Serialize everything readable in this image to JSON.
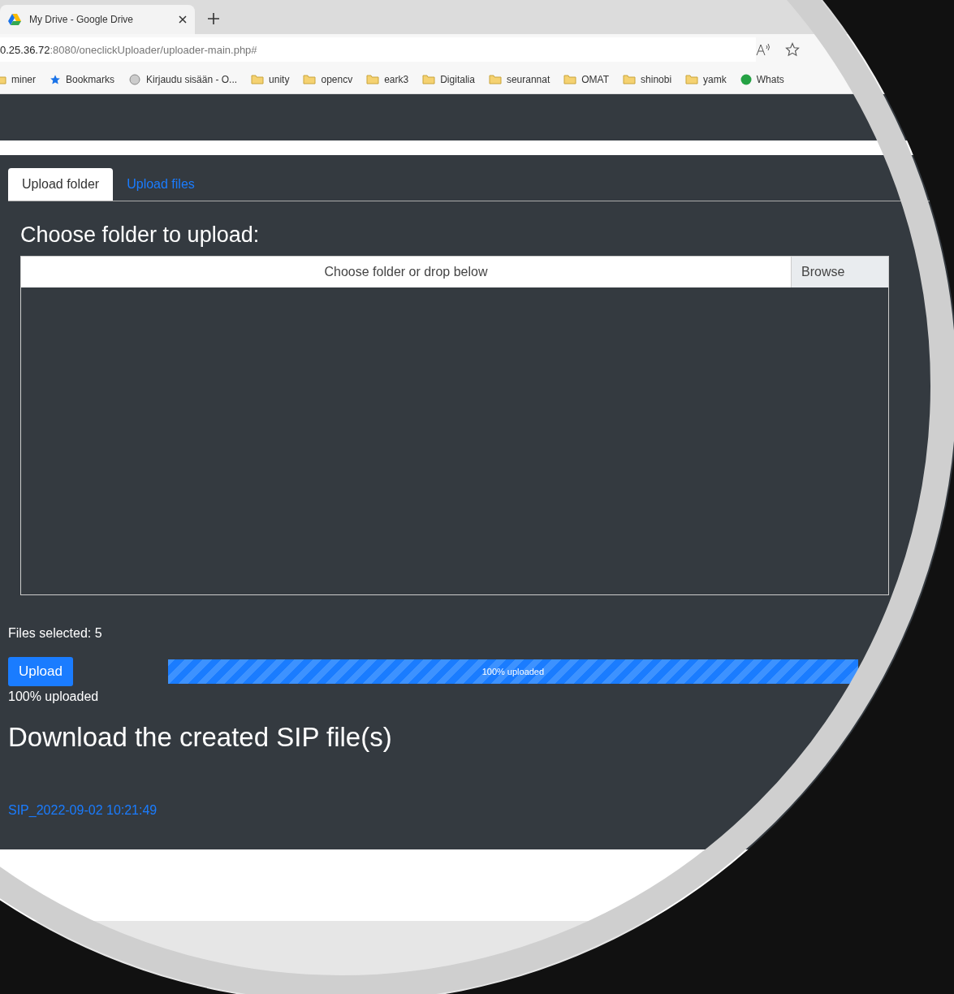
{
  "browser": {
    "tab_title": "My Drive - Google Drive",
    "address_host": "0.25.36.72",
    "address_rest": ":8080/oneclickUploader/uploader-main.php#",
    "bookmarks": [
      {
        "kind": "folder",
        "label": "miner"
      },
      {
        "kind": "star",
        "label": "Bookmarks"
      },
      {
        "kind": "site",
        "label": "Kirjaudu sisään - O..."
      },
      {
        "kind": "folder",
        "label": "unity"
      },
      {
        "kind": "folder",
        "label": "opencv"
      },
      {
        "kind": "folder",
        "label": "eark3"
      },
      {
        "kind": "folder",
        "label": "Digitalia"
      },
      {
        "kind": "folder",
        "label": "seurannat"
      },
      {
        "kind": "folder",
        "label": "OMAT"
      },
      {
        "kind": "folder",
        "label": "shinobi"
      },
      {
        "kind": "folder",
        "label": "yamk"
      },
      {
        "kind": "whatsapp",
        "label": "Whats"
      }
    ]
  },
  "tabs": [
    {
      "label": "Upload folder",
      "selected": true
    },
    {
      "label": "Upload files",
      "selected": false
    }
  ],
  "heading": "Choose folder to upload:",
  "folder_input": {
    "placeholder": "Choose folder or drop below",
    "button": "Browse"
  },
  "files_selected": "Files selected: 5",
  "upload_button": "Upload",
  "progress": {
    "level": 1,
    "label": "100% uploaded"
  },
  "status": "100% uploaded",
  "download_heading": "Download the created SIP file(s)",
  "sip_link": "SIP_2022-09-02 10:21:49"
}
